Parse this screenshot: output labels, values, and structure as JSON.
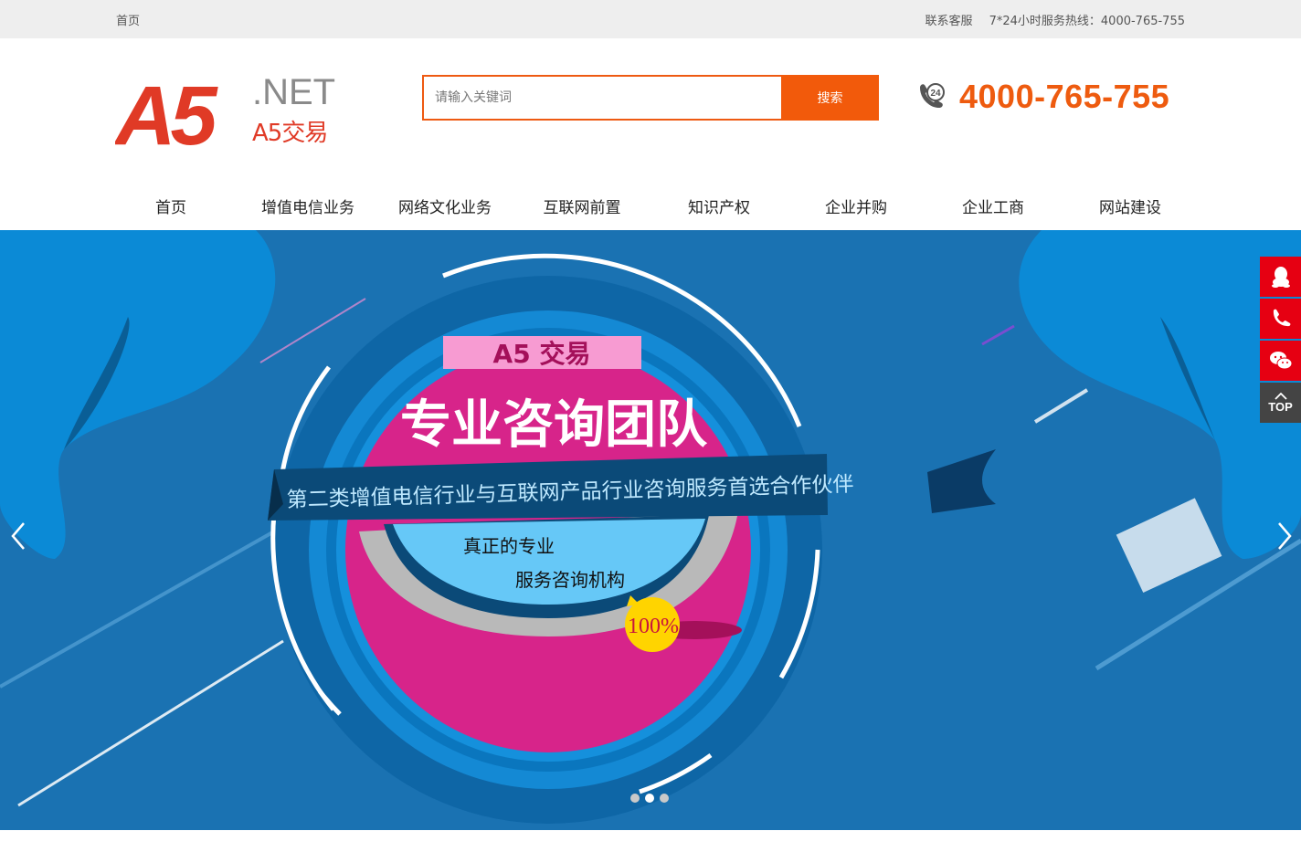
{
  "topbar": {
    "home_link": "首页",
    "service_link": "联系客服",
    "hotline_text": "7*24小时服务热线：4000-765-755"
  },
  "logo": {
    "mark": "A5",
    "suffix": ".NET",
    "name": "A5交易"
  },
  "search": {
    "placeholder": "请输入关键词",
    "value": "",
    "button_label": "搜索"
  },
  "hotline": {
    "number": "4000-765-755",
    "badge": "24"
  },
  "nav": {
    "items": [
      {
        "label": "首页"
      },
      {
        "label": "增值电信业务"
      },
      {
        "label": "网络文化业务"
      },
      {
        "label": "互联网前置"
      },
      {
        "label": "知识产权"
      },
      {
        "label": "企业并购"
      },
      {
        "label": "企业工商"
      },
      {
        "label": "网站建设"
      }
    ]
  },
  "banner": {
    "tag": "A5 交易",
    "headline": "专业咨询团队",
    "ribbon": "第二类增值电信行业与互联网产品行业咨询服务首选合作伙伴",
    "line1": "真正的专业",
    "line2": "服务咨询机构",
    "badge": "100%",
    "active_slide": 2,
    "slide_count": 3
  },
  "side": {
    "qq_icon": "qq-icon",
    "phone_icon": "phone-icon",
    "wechat_icon": "wechat-icon",
    "top_label": "TOP"
  },
  "colors": {
    "accent": "#f25a0b",
    "banner_bg": "#1a72b2",
    "circle": "#d7248a",
    "side_red": "#e60012"
  }
}
